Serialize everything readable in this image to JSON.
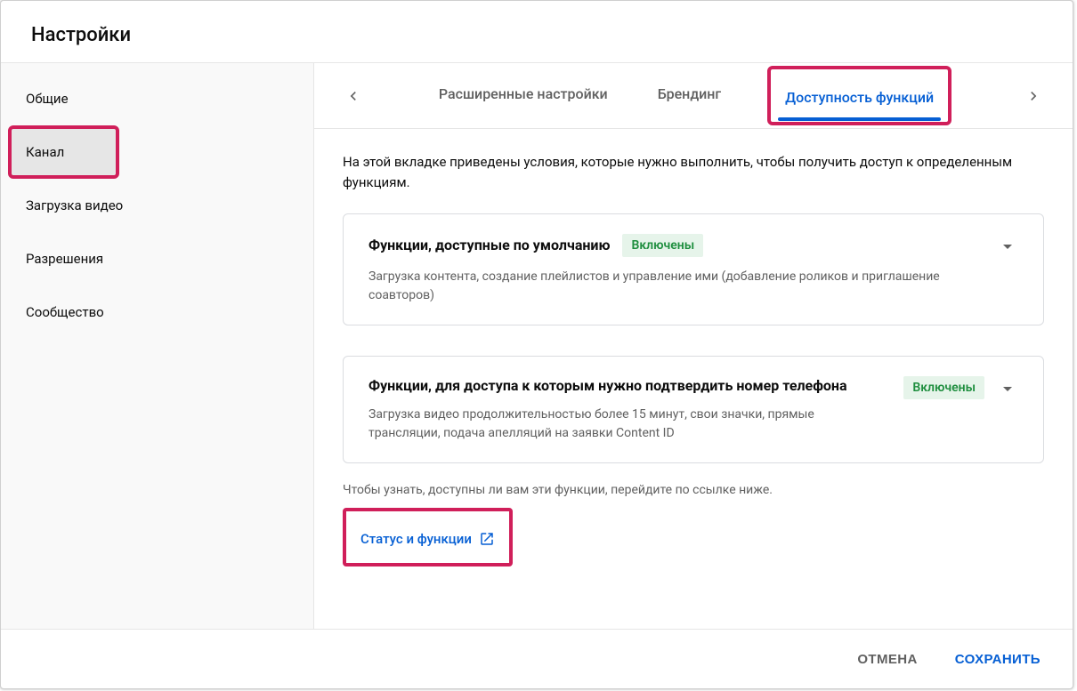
{
  "dialog": {
    "title": "Настройки"
  },
  "sidebar": {
    "items": [
      {
        "label": "Общие"
      },
      {
        "label": "Канал"
      },
      {
        "label": "Загрузка видео"
      },
      {
        "label": "Разрешения"
      },
      {
        "label": "Сообщество"
      }
    ]
  },
  "tabs": {
    "items": [
      {
        "label": "Расширенные настройки"
      },
      {
        "label": "Брендинг"
      },
      {
        "label": "Доступность функций"
      }
    ]
  },
  "intro": "На этой вкладке приведены условия, которые нужно выполнить, чтобы получить доступ к определенным функциям.",
  "cards": [
    {
      "title": "Функции, доступные по умолчанию",
      "status": "Включены",
      "desc": "Загрузка контента, создание плейлистов и управление ими (добавление роликов и приглашение соавторов)"
    },
    {
      "title": "Функции, для доступа к которым нужно подтвердить номер телефона",
      "status": "Включены",
      "desc": "Загрузка видео продолжительностью более 15 минут, свои значки, прямые трансляции, подача апелляций на заявки Content ID"
    }
  ],
  "footnote": "Чтобы узнать, доступны ли вам эти функции, перейдите по ссылке ниже.",
  "link_label": "Статус и функции",
  "footer": {
    "cancel": "ОТМЕНА",
    "save": "СОХРАНИТЬ"
  }
}
